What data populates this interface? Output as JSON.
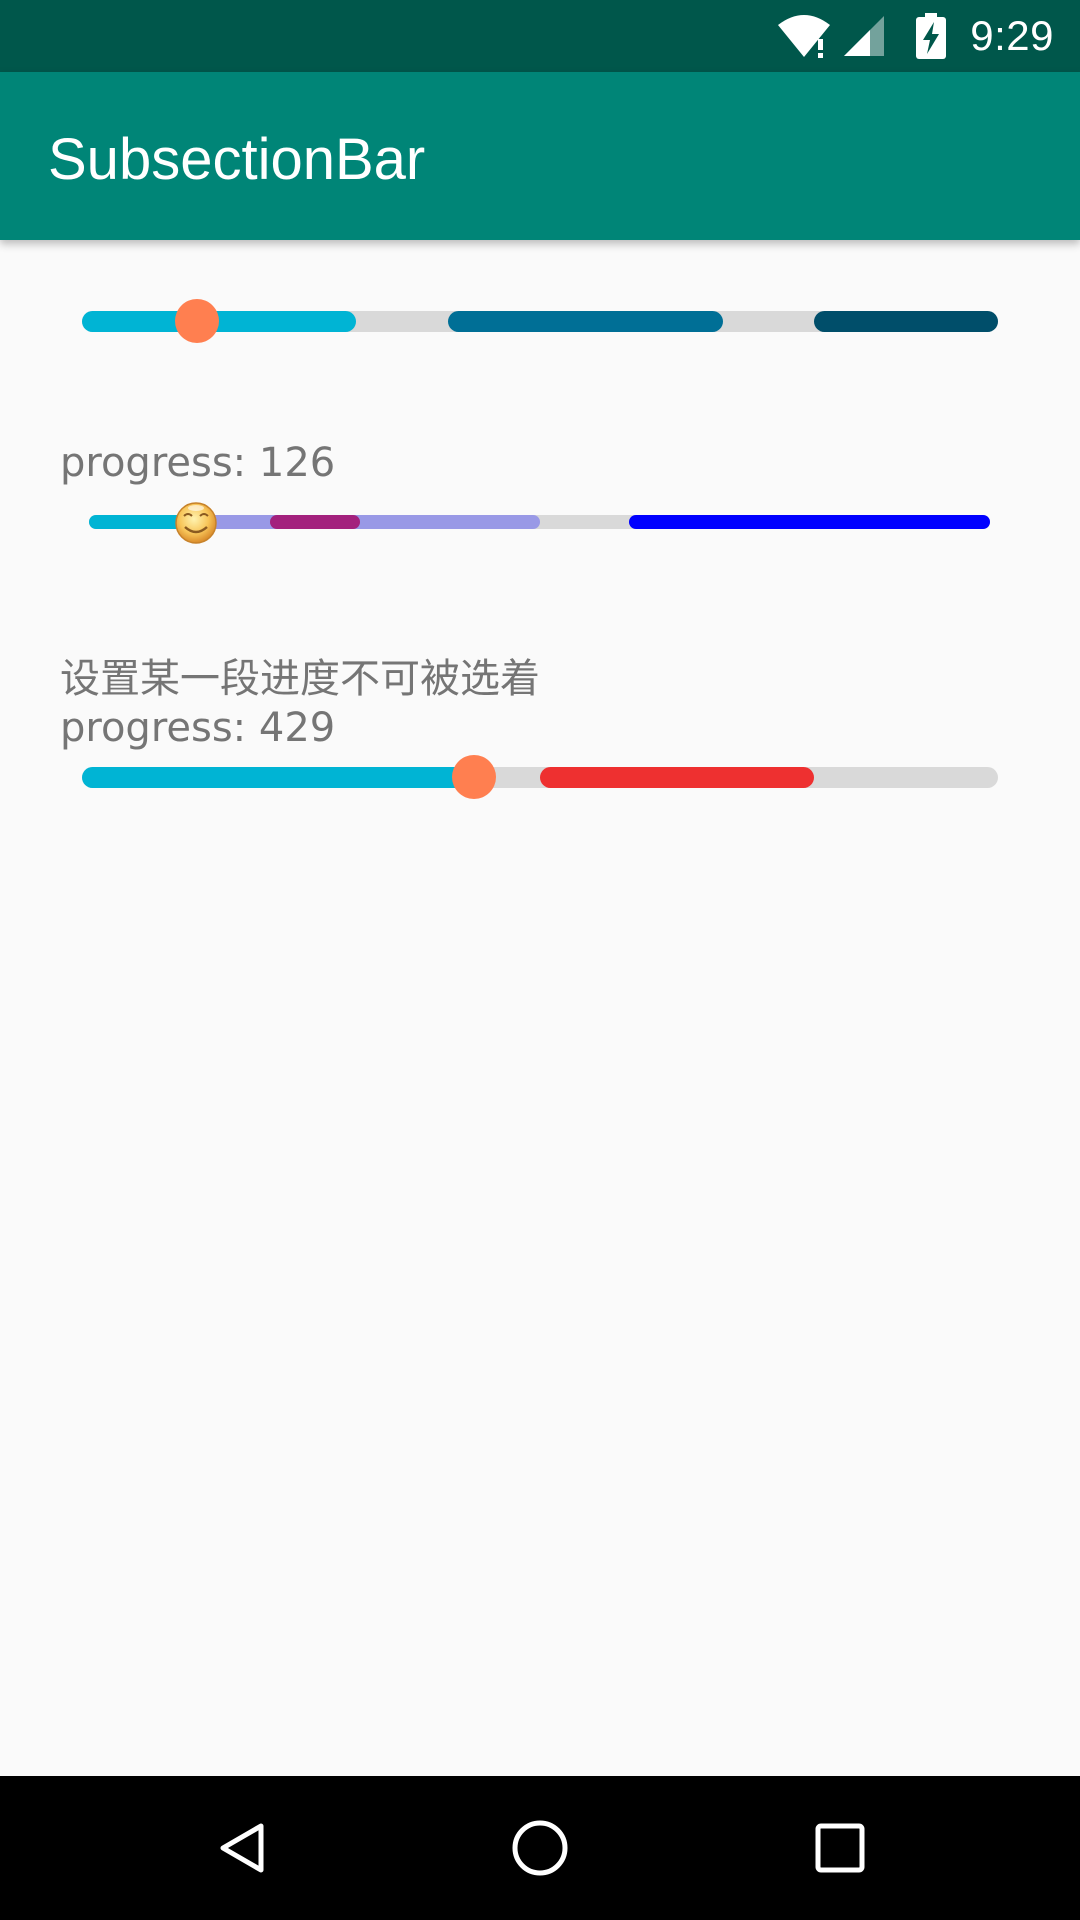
{
  "status_bar": {
    "time": "9:29",
    "icons": [
      "wifi-icon",
      "signal-icon",
      "battery-charging-icon"
    ]
  },
  "app_bar": {
    "title": "SubsectionBar"
  },
  "bar1": {
    "progress_fraction": 0.125,
    "segments": [
      {
        "color": "#00b4d4"
      },
      {
        "color": "#006f96"
      },
      {
        "color": "#004e6a"
      }
    ],
    "track_color": "#d9d9d9",
    "thumb_color": "#ff7f50"
  },
  "bar2": {
    "label": "progress: 126",
    "progress": 126,
    "thumb_icon": "smiley-face-icon",
    "segment_colors": [
      "#00b4d4",
      "#9999e6",
      "#a3217d",
      "#9999e6",
      "#0000ff"
    ],
    "track_color": "#d9d9d9"
  },
  "bar3": {
    "description": "设置某一段进度不可被选着",
    "label": "progress: 429",
    "progress": 429,
    "segment_colors": [
      "#00b4d4",
      "#ee3030"
    ],
    "track_color": "#d9d9d9",
    "thumb_color": "#ff7f50"
  },
  "nav_bar": {
    "buttons": [
      "back-icon",
      "home-icon",
      "recents-icon"
    ]
  }
}
